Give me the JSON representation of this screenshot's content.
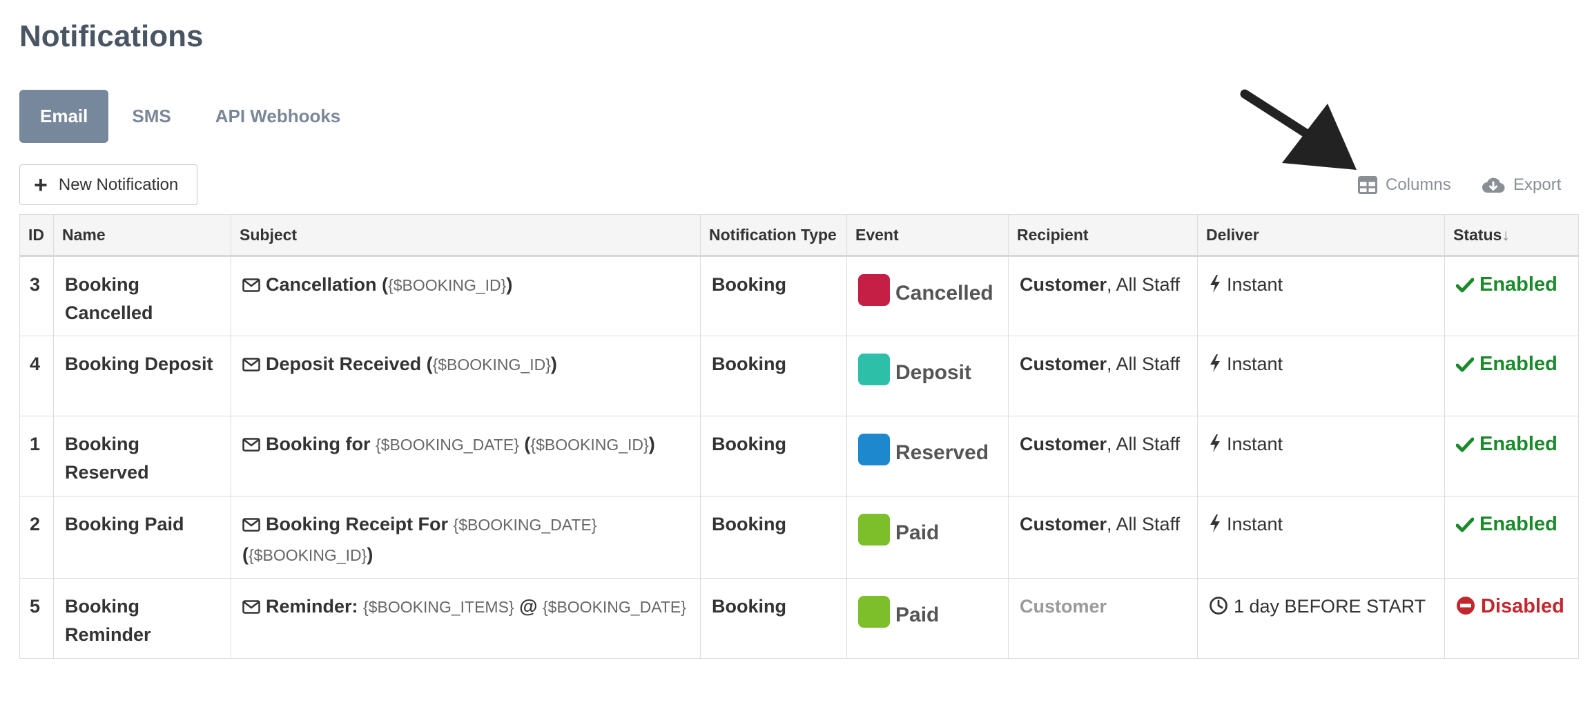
{
  "page": {
    "title": "Notifications"
  },
  "tabs": [
    {
      "label": "Email",
      "active": true
    },
    {
      "label": "SMS",
      "active": false
    },
    {
      "label": "API Webhooks",
      "active": false
    }
  ],
  "toolbar": {
    "new_label": "New Notification",
    "columns_label": "Columns",
    "export_label": "Export"
  },
  "table": {
    "headers": [
      "ID",
      "Name",
      "Subject",
      "Notification Type",
      "Event",
      "Recipient",
      "Deliver",
      "Status"
    ],
    "sort_indicator": "↓",
    "rows": [
      {
        "id": "3",
        "name": "Booking Cancelled",
        "subject": [
          {
            "t": "Cancellation (",
            "v": false
          },
          {
            "t": "{$BOOKING_ID}",
            "v": true
          },
          {
            "t": ")",
            "v": false
          }
        ],
        "type": "Booking",
        "event": "Cancelled",
        "event_color": "#c51f45",
        "recipient": [
          {
            "t": "Customer",
            "s": "strong"
          },
          {
            "t": ", All Staff",
            "s": "normal"
          }
        ],
        "deliver": "Instant",
        "deliver_icon": "bolt-icon",
        "status": "Enabled",
        "status_enabled": true
      },
      {
        "id": "4",
        "name": "Booking Deposit",
        "subject": [
          {
            "t": "Deposit Received (",
            "v": false
          },
          {
            "t": "{$BOOKING_ID}",
            "v": true
          },
          {
            "t": ")",
            "v": false
          }
        ],
        "type": "Booking",
        "event": "Deposit",
        "event_color": "#2dbfa8",
        "recipient": [
          {
            "t": "Customer",
            "s": "strong"
          },
          {
            "t": ", All Staff",
            "s": "normal"
          }
        ],
        "deliver": "Instant",
        "deliver_icon": "bolt-icon",
        "status": "Enabled",
        "status_enabled": true
      },
      {
        "id": "1",
        "name": "Booking Reserved",
        "subject": [
          {
            "t": "Booking for ",
            "v": false
          },
          {
            "t": "{$BOOKING_DATE}",
            "v": true
          },
          {
            "t": " (",
            "v": false
          },
          {
            "t": "{$BOOKING_ID}",
            "v": true
          },
          {
            "t": ")",
            "v": false
          }
        ],
        "type": "Booking",
        "event": "Reserved",
        "event_color": "#1e88cf",
        "recipient": [
          {
            "t": "Customer",
            "s": "strong"
          },
          {
            "t": ", All Staff",
            "s": "normal"
          }
        ],
        "deliver": "Instant",
        "deliver_icon": "bolt-icon",
        "status": "Enabled",
        "status_enabled": true
      },
      {
        "id": "2",
        "name": "Booking Paid",
        "subject": [
          {
            "t": "Booking Receipt For ",
            "v": false
          },
          {
            "t": "{$BOOKING_DATE}",
            "v": true
          },
          {
            "t": " (",
            "v": false
          },
          {
            "t": "{$BOOKING_ID}",
            "v": true
          },
          {
            "t": ")",
            "v": false
          }
        ],
        "type": "Booking",
        "event": "Paid",
        "event_color": "#7cbf2a",
        "recipient": [
          {
            "t": "Customer",
            "s": "strong"
          },
          {
            "t": ", All Staff",
            "s": "normal"
          }
        ],
        "deliver": "Instant",
        "deliver_icon": "bolt-icon",
        "status": "Enabled",
        "status_enabled": true
      },
      {
        "id": "5",
        "name": "Booking Reminder",
        "subject": [
          {
            "t": "Reminder: ",
            "v": false
          },
          {
            "t": "{$BOOKING_ITEMS}",
            "v": true
          },
          {
            "t": " @ ",
            "v": false
          },
          {
            "t": "{$BOOKING_DATE}",
            "v": true
          }
        ],
        "type": "Booking",
        "event": "Paid",
        "event_color": "#7cbf2a",
        "recipient": [
          {
            "t": "Customer",
            "s": "muted"
          }
        ],
        "deliver": "1 day BEFORE START",
        "deliver_icon": "clock-icon",
        "status": "Disabled",
        "status_enabled": false
      }
    ]
  }
}
